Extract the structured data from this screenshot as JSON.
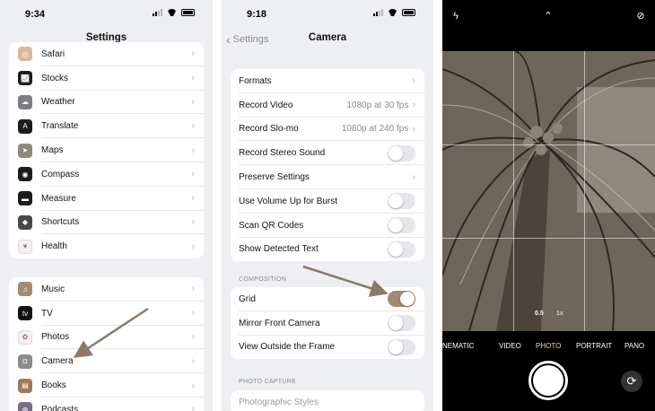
{
  "left_screen": {
    "time": "9:34",
    "title": "Settings",
    "group1": [
      {
        "label": "Safari",
        "icon": "safari-icon",
        "color": "#d9b896",
        "glyph": "◎"
      },
      {
        "label": "Stocks",
        "icon": "stocks-icon",
        "color": "#1c1c1e",
        "glyph": "📈"
      },
      {
        "label": "Weather",
        "icon": "weather-icon",
        "color": "#7a7f86",
        "glyph": "☁"
      },
      {
        "label": "Translate",
        "icon": "translate-icon",
        "color": "#1c1c1e",
        "glyph": "A"
      },
      {
        "label": "Maps",
        "icon": "maps-icon",
        "color": "#8d8a7c",
        "glyph": "➤"
      },
      {
        "label": "Compass",
        "icon": "compass-icon",
        "color": "#1c1c1e",
        "glyph": "◉"
      },
      {
        "label": "Measure",
        "icon": "measure-icon",
        "color": "#1c1c1e",
        "glyph": "▬"
      },
      {
        "label": "Shortcuts",
        "icon": "shortcuts-icon",
        "color": "#4b4743",
        "glyph": "◆"
      },
      {
        "label": "Health",
        "icon": "health-icon",
        "color": "#f4f1ee",
        "glyph": "♥"
      }
    ],
    "group2": [
      {
        "label": "Music",
        "icon": "music-icon",
        "color": "#a38c74",
        "glyph": "♫"
      },
      {
        "label": "TV",
        "icon": "tv-icon",
        "color": "#111111",
        "glyph": "tv"
      },
      {
        "label": "Photos",
        "icon": "photos-icon",
        "color": "#f4f1ee",
        "glyph": "✿"
      },
      {
        "label": "Camera",
        "icon": "camera-icon",
        "color": "#8b8b8e",
        "glyph": "◘"
      },
      {
        "label": "Books",
        "icon": "books-icon",
        "color": "#a07a55",
        "glyph": "▤"
      },
      {
        "label": "Podcasts",
        "icon": "podcasts-icon",
        "color": "#7b6a8a",
        "glyph": "◍"
      }
    ]
  },
  "middle_screen": {
    "time": "9:18",
    "back_label": "Settings",
    "title": "Camera",
    "group1": [
      {
        "label": "Formats",
        "kind": "chevron",
        "value": ""
      },
      {
        "label": "Record Video",
        "kind": "chevron",
        "value": "1080p at 30 fps"
      },
      {
        "label": "Record Slo-mo",
        "kind": "chevron",
        "value": "1080p at 240 fps"
      },
      {
        "label": "Record Stereo Sound",
        "kind": "toggle",
        "on": false
      },
      {
        "label": "Preserve Settings",
        "kind": "chevron",
        "value": ""
      },
      {
        "label": "Use Volume Up for Burst",
        "kind": "toggle",
        "on": false
      },
      {
        "label": "Scan QR Codes",
        "kind": "toggle",
        "on": false
      },
      {
        "label": "Show Detected Text",
        "kind": "toggle",
        "on": false
      }
    ],
    "composition_header": "COMPOSITION",
    "composition": [
      {
        "label": "Grid",
        "kind": "toggle",
        "on": true
      },
      {
        "label": "Mirror Front Camera",
        "kind": "toggle",
        "on": false
      },
      {
        "label": "View Outside the Frame",
        "kind": "toggle",
        "on": false
      }
    ],
    "photo_capture_header": "PHOTO CAPTURE",
    "photo_capture": [
      {
        "label": "Photographic Styles",
        "kind": "none"
      }
    ]
  },
  "camera_screen": {
    "modes": [
      "CINEMATIC",
      "VIDEO",
      "PHOTO",
      "PORTRAIT",
      "PANO"
    ],
    "active_mode": "PHOTO",
    "zoom_levels": [
      "0.5",
      "1x"
    ],
    "icons": [
      "flash-icon",
      "chevron-up-icon",
      "live-photo-icon",
      "shutter-button",
      "flip-camera-icon"
    ]
  },
  "colors": {
    "toggle_on": "#a08a72",
    "annotation_arrow": "#8c7a66",
    "active_mode": "#f6d78f"
  }
}
